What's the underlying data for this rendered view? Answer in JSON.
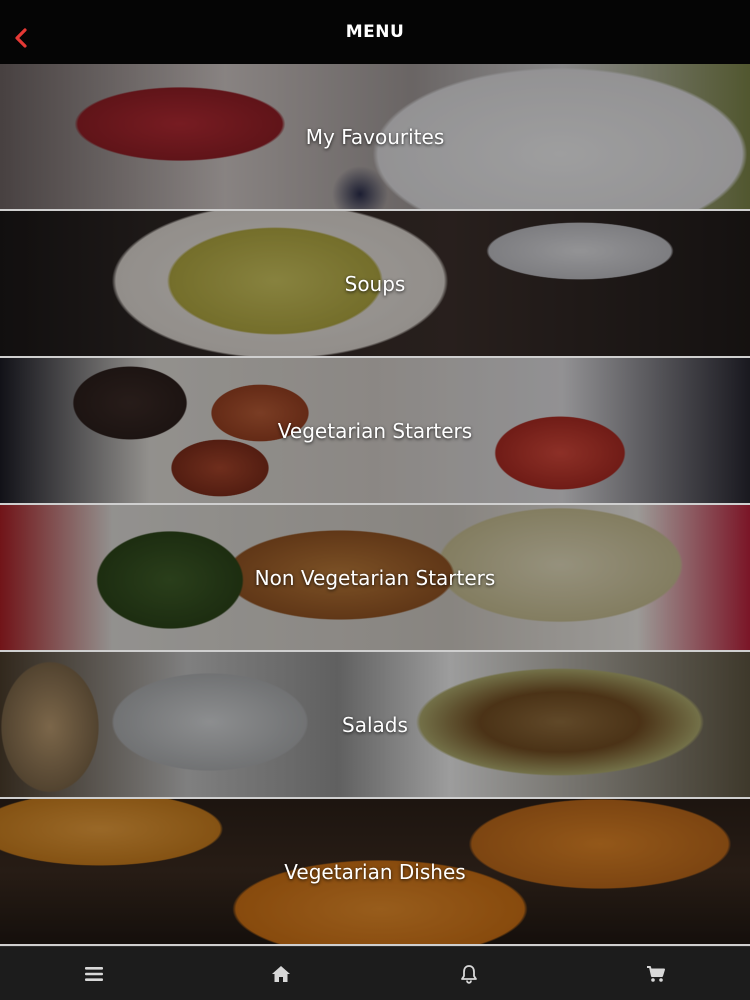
{
  "header": {
    "title": "MENU",
    "back_icon": "chevron-left-icon",
    "accent_color": "#e53935"
  },
  "menu": {
    "categories": [
      {
        "label": "My Favourites"
      },
      {
        "label": "Soups"
      },
      {
        "label": "Vegetarian Starters"
      },
      {
        "label": "Non Vegetarian Starters"
      },
      {
        "label": "Salads"
      },
      {
        "label": "Vegetarian Dishes"
      }
    ]
  },
  "bottom_nav": {
    "items": [
      {
        "icon": "menu-icon"
      },
      {
        "icon": "home-icon"
      },
      {
        "icon": "bell-icon"
      },
      {
        "icon": "cart-icon"
      }
    ]
  }
}
